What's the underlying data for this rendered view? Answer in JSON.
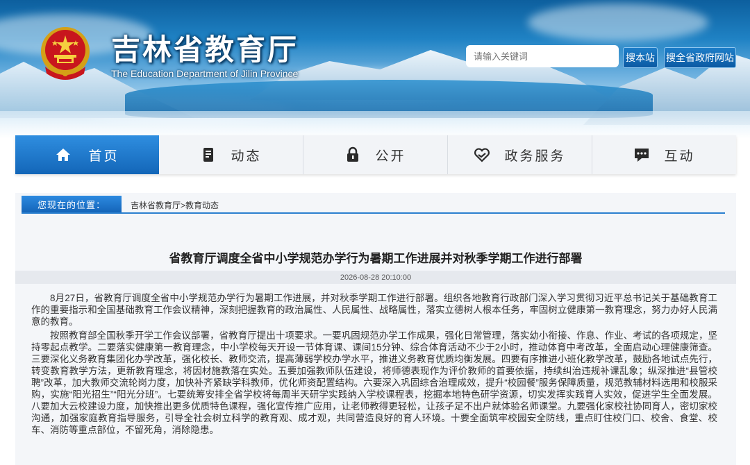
{
  "header": {
    "title": "吉林省教育厅",
    "subtitle": "The Education Department of Jilin Province",
    "search_placeholder": "请输入关键词",
    "search_site_label": "搜本站",
    "search_gov_label": "搜全省政府网站"
  },
  "nav": {
    "items": [
      {
        "label": "首页",
        "icon": "home-icon",
        "active": true
      },
      {
        "label": "动态",
        "icon": "news-icon",
        "active": false
      },
      {
        "label": "公开",
        "icon": "lock-icon",
        "active": false
      },
      {
        "label": "政务服务",
        "icon": "handshake-icon",
        "active": false
      },
      {
        "label": "互动",
        "icon": "chat-icon",
        "active": false
      }
    ]
  },
  "breadcrumb": {
    "label": "您现在的位置：",
    "home": "吉林省教育厅",
    "separator": ">",
    "current": "教育动态"
  },
  "article": {
    "title": "省教育厅调度全省中小学规范办学行为暑期工作进展并对秋季学期工作进行部署",
    "datetime": "2026-08-28 20:10:00",
    "paragraphs": [
      "8月27日，省教育厅调度全省中小学规范办学行为暑期工作进展，并对秋季学期工作进行部署。组织各地教育行政部门深入学习贯彻习近平总书记关于基础教育工作的重要指示和全国基础教育工作会议精神，深刻把握教育的政治属性、人民属性、战略属性，落实立德树人根本任务，牢固树立健康第一教育理念，努力办好人民满意的教育。",
      "按照教育部全国秋季开学工作会议部署，省教育厅提出十项要求。一要巩固规范办学工作成果，强化日常管理，落实幼小衔接、作息、作业、考试的各项规定，坚持零起点教学。二要落实健康第一教育理念，中小学校每天开设一节体育课、课间15分钟、综合体育活动不少于2小时，推动体育中考改革，全面启动心理健康筛查。三要深化义务教育集团化办学改革，强化校长、教师交流，提高薄弱学校办学水平，推进义务教育优质均衡发展。四要有序推进小班化教学改革，鼓励各地试点先行，转变教育教学方法，更新教育理念，将因材施教落在实处。五要加强教师队伍建设，将师德表现作为评价教师的首要依据，持续纠治违规补课乱象；纵深推进“县管校聘”改革，加大教师交流轮岗力度，加快补齐紧缺学科教师，优化师资配置结构。六要深入巩固综合治理成效，提升“校园餐”服务保障质量，规范教辅材料选用和校服采购，实施“阳光招生”“阳光分班”。七要统筹安排全省学校将每周半天研学实践纳入学校课程表，挖掘本地特色研学资源，切实发挥实践育人实效，促进学生全面发展。八要加大云校建设力度，加快推出更多优质特色课程，强化宣传推广应用，让老师教得更轻松，让孩子足不出户就体验名师课堂。九要强化家校社协同育人，密切家校沟通，加强家庭教育指导服务，引导全社会树立科学的教育观、成才观，共同营造良好的育人环境。十要全面筑牢校园安全防线，重点盯住校门口、校舍、食堂、校车、消防等重点部位，不留死角，消除隐患。"
    ]
  },
  "colors": {
    "accent": "#1a72c4",
    "nav_active": "#1f7ad2",
    "title_red": "#c8161d"
  }
}
